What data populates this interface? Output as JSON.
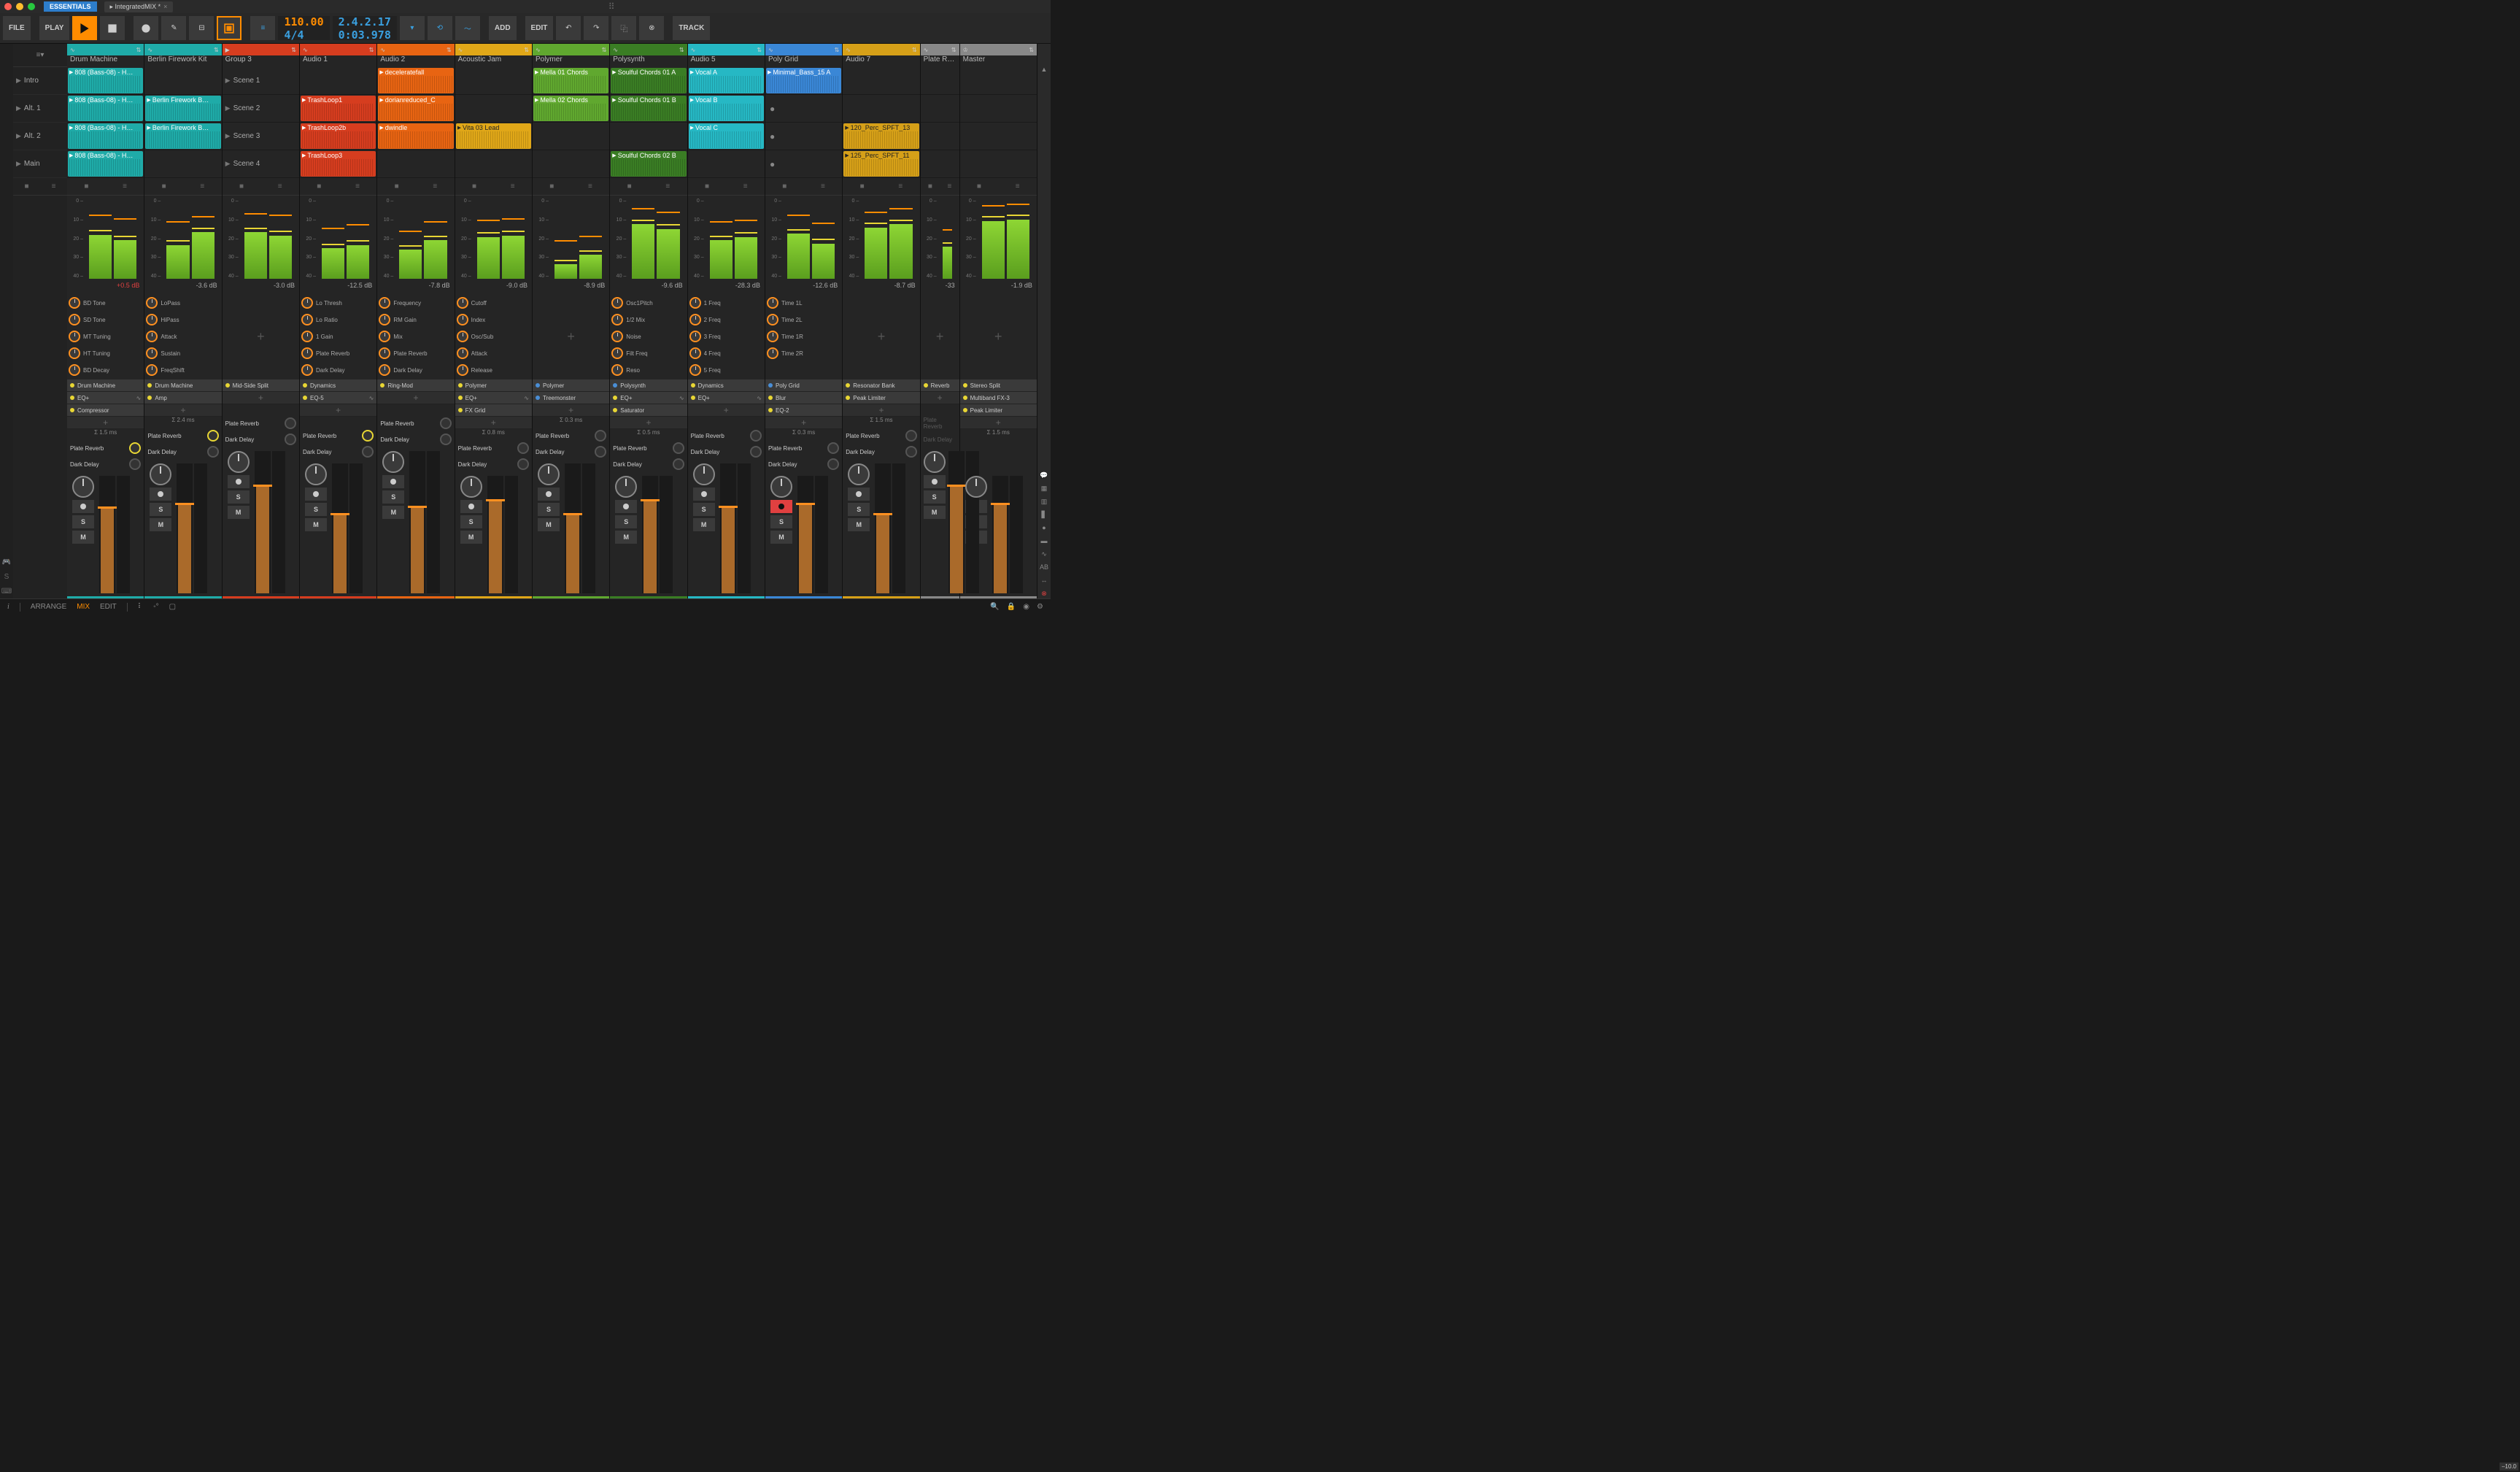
{
  "titlebar": {
    "badge": "ESSENTIALS",
    "document": "IntegratedMIX *"
  },
  "toolbar": {
    "file": "FILE",
    "play": "PLAY",
    "add": "ADD",
    "edit": "EDIT",
    "track": "TRACK",
    "tempo": "110.00",
    "sig": "4/4",
    "pos_bars": "2.4.2.17",
    "pos_time": "0:03.978"
  },
  "scenes": [
    "Intro",
    "Alt. 1",
    "Alt. 2",
    "Main"
  ],
  "meter_scale": [
    "0 –",
    "10 –",
    "20 –",
    "30 –",
    "40 –"
  ],
  "send_labels": {
    "a": "Plate Reverb",
    "b": "Dark Delay"
  },
  "fader_btns": {
    "solo": "S",
    "mute": "M"
  },
  "tracks": [
    {
      "name": "Drum Machine",
      "color": "#1faba8",
      "db": "+0.5 dB",
      "db_red": true,
      "fader": "–2.7",
      "fh": 72,
      "meters": [
        [
          55,
          78
        ],
        [
          48,
          74
        ]
      ],
      "clips": [
        {
          "t": "808 (Bass-08) - H…",
          "c": "teal"
        },
        {
          "t": "808 (Bass-08) - H…",
          "c": "teal"
        },
        {
          "t": "808 (Bass-08) - H…",
          "c": "teal"
        },
        {
          "t": "808 (Bass-08) - H…",
          "c": "teal"
        }
      ],
      "knobs": [
        "BD Tone",
        "SD Tone",
        "MT Tuning",
        "HT Tuning",
        "BD Decay"
      ],
      "devs": [
        {
          "n": "Drum Machine"
        },
        {
          "n": "EQ+",
          "wave": true
        },
        {
          "n": "Compressor"
        }
      ],
      "lat": "Σ 1.5 ms",
      "sendA": true,
      "sendB": false
    },
    {
      "name": "Berlin Firework Kit",
      "color": "#1faba8",
      "db": "-3.6 dB",
      "fader": "–3.2",
      "fh": 68,
      "meters": [
        [
          42,
          70
        ],
        [
          58,
          76
        ]
      ],
      "clips": [
        null,
        {
          "t": "Berlin Firework B…",
          "c": "teal"
        },
        {
          "t": "Berlin Firework B…",
          "c": "teal"
        },
        null
      ],
      "knobs": [
        "LoPass",
        "HiPass",
        "Attack",
        "Sustain",
        "FreqShift"
      ],
      "devs": [
        {
          "n": "Drum Machine"
        },
        {
          "n": "Amp"
        }
      ],
      "lat": "Σ 2.4 ms",
      "sendA": true,
      "sendB": false
    },
    {
      "name": "Group 3",
      "color": "#d63d1f",
      "db": "-3.0 dB",
      "fader": "0.0",
      "fh": 75,
      "is_group": true,
      "meters": [
        [
          58,
          80
        ],
        [
          54,
          78
        ]
      ],
      "clips": [
        {
          "t": "Scene 1",
          "plain": true
        },
        {
          "t": "Scene 2",
          "plain": true
        },
        {
          "t": "Scene 3",
          "plain": true
        },
        {
          "t": "Scene 4",
          "plain": true
        }
      ],
      "knobs": [],
      "devs": [
        {
          "n": "Mid-Side Split"
        }
      ],
      "lat": "",
      "sendA": false,
      "sendB": false,
      "armed": false
    },
    {
      "name": "Audio 1",
      "color": "#d63d1f",
      "db": "-12.5 dB",
      "fader": "–10.0",
      "fh": 60,
      "meters": [
        [
          38,
          62
        ],
        [
          42,
          66
        ]
      ],
      "clips": [
        null,
        {
          "t": "TrashLoop1",
          "c": "red"
        },
        {
          "t": "TrashLoop2b",
          "c": "red"
        },
        {
          "t": "TrashLoop3",
          "c": "red"
        }
      ],
      "knobs": [
        "Lo Thresh",
        "Lo Ratio",
        "1 Gain",
        "Plate Reverb",
        "Dark Delay"
      ],
      "devs": [
        {
          "n": "Dynamics"
        },
        {
          "n": "EQ-5",
          "wave": true
        }
      ],
      "lat": "",
      "sendA": true,
      "sendB": false
    },
    {
      "name": "Audio 2",
      "color": "#e86412",
      "db": "-7.8 dB",
      "fader": "–10.0",
      "fh": 60,
      "meters": [
        [
          36,
          58
        ],
        [
          48,
          70
        ]
      ],
      "clips": [
        {
          "t": "deceleratefall",
          "c": "orange"
        },
        {
          "t": "dorianreduced_C",
          "c": "orange"
        },
        {
          "t": "dwindle",
          "c": "orange"
        },
        null
      ],
      "knobs": [
        "Frequency",
        "RM Gain",
        "Mix",
        "Plate Reverb",
        "Dark Delay"
      ],
      "devs": [
        {
          "n": "Ring-Mod"
        }
      ],
      "lat": "",
      "sendA": false,
      "sendB": false
    },
    {
      "name": "Acoustic Jam",
      "color": "#e0a718",
      "db": "-9.0 dB",
      "fader": "+3.3",
      "fh": 78,
      "meters": [
        [
          52,
          72
        ],
        [
          54,
          74
        ]
      ],
      "clips": [
        null,
        null,
        {
          "t": "Vita 03 Lead",
          "c": "yellow"
        },
        null
      ],
      "knobs": [
        "Cutoff",
        "Index",
        "Osc/Sub",
        "Attack",
        "Release"
      ],
      "devs": [
        {
          "n": "Polymer"
        },
        {
          "n": "EQ+",
          "wave": true
        },
        {
          "n": "FX Grid"
        }
      ],
      "lat": "Σ 0.8 ms",
      "sendA": false,
      "sendB": false
    },
    {
      "name": "Polymer",
      "color": "#60a82f",
      "db": "-8.9 dB",
      "fader": "–10.0",
      "fh": 60,
      "meters": [
        [
          18,
          46
        ],
        [
          30,
          52
        ]
      ],
      "clips": [
        {
          "t": "Mella 01 Chords",
          "c": "green"
        },
        {
          "t": "Mella 02 Chords",
          "c": "green"
        },
        null,
        null
      ],
      "knobs": [],
      "devs": [
        {
          "n": "Polymer",
          "moon": true
        },
        {
          "n": "Treemonster",
          "moon": true
        }
      ],
      "lat": "Σ 0.3 ms",
      "sendA": false,
      "sendB": false
    },
    {
      "name": "Polysynth",
      "color": "#3a7d24",
      "db": "-9.6 dB",
      "fader": "+2.0",
      "fh": 78,
      "meters": [
        [
          68,
          86
        ],
        [
          62,
          82
        ]
      ],
      "clips": [
        {
          "t": "Soulful Chords 01 A",
          "c": "green-d"
        },
        {
          "t": "Soulful Chords 01 B",
          "c": "green-d"
        },
        null,
        {
          "t": "Soulful Chords 02 B",
          "c": "green-d"
        }
      ],
      "knobs": [
        "Osc1Pitch",
        "1/2 Mix",
        "Noise",
        "Filt Freq",
        "Reso"
      ],
      "devs": [
        {
          "n": "Polysynth",
          "moon": true
        },
        {
          "n": "EQ+",
          "wave": true
        },
        {
          "n": "Saturator"
        }
      ],
      "lat": "Σ 0.5 ms",
      "sendA": false,
      "sendB": false
    },
    {
      "name": "Audio 5",
      "color": "#26b8c4",
      "db": "-28.3 dB",
      "fader": "–4.4",
      "fh": 66,
      "meters": [
        [
          48,
          70
        ],
        [
          52,
          72
        ]
      ],
      "clips": [
        {
          "t": "Vocal A",
          "c": "cyan"
        },
        {
          "t": "Vocal B",
          "c": "cyan"
        },
        {
          "t": "Vocal C",
          "c": "cyan"
        },
        null
      ],
      "knobs": [
        "1 Freq",
        "2 Freq",
        "3 Freq",
        "4 Freq",
        "5 Freq"
      ],
      "devs": [
        {
          "n": "Dynamics"
        },
        {
          "n": "EQ+",
          "wave": true
        }
      ],
      "lat": "",
      "sendA": false,
      "sendB": false
    },
    {
      "name": "Poly Grid",
      "color": "#3a87d6",
      "db": "-12.6 dB",
      "fader": "0.0",
      "fh": 75,
      "armed": true,
      "meters": [
        [
          56,
          78
        ],
        [
          44,
          68
        ]
      ],
      "clips": [
        {
          "t": "Minimal_Bass_15 A",
          "c": "blue"
        },
        {
          "t": "",
          "dot": true
        },
        {
          "t": "",
          "dot": true
        },
        {
          "t": "",
          "dot": true
        }
      ],
      "knobs": [
        "Time 1L",
        "Time 2L",
        "Time 1R",
        "Time 2R"
      ],
      "devs": [
        {
          "n": "Poly Grid",
          "moon": true
        },
        {
          "n": "Blur"
        },
        {
          "n": "EQ-2"
        }
      ],
      "lat": "Σ 0.3 ms",
      "sendA": false,
      "sendB": false
    },
    {
      "name": "Audio 7",
      "color": "#d6a018",
      "db": "-8.7 dB",
      "fader": "–10.0",
      "fh": 60,
      "meters": [
        [
          64,
          82
        ],
        [
          68,
          86
        ]
      ],
      "clips": [
        null,
        null,
        {
          "t": "120_Perc_SPFT_13",
          "c": "amber"
        },
        {
          "t": "125_Perc_SPFT_11",
          "c": "amber"
        }
      ],
      "knobs": [],
      "devs": [
        {
          "n": "Resonator Bank"
        },
        {
          "n": "Peak Limiter"
        }
      ],
      "lat": "Σ 1.5 ms",
      "sendA": false,
      "sendB": false
    },
    {
      "name": "Plate Reverb",
      "color": "#888",
      "db": "-33",
      "fader": "",
      "fh": 75,
      "narrow": true,
      "meters": [
        [
          40,
          60
        ]
      ],
      "clips": [
        null,
        null,
        null,
        null
      ],
      "knobs": [],
      "devs": [
        {
          "n": "Reverb"
        }
      ],
      "lat": "",
      "sendA": false,
      "sendB": false,
      "no_sends": true
    },
    {
      "name": "Master",
      "color": "#888",
      "db": "-1.9 dB",
      "fader": "",
      "fh": 75,
      "is_master": true,
      "meters": [
        [
          72,
          90
        ],
        [
          74,
          92
        ]
      ],
      "clips": [
        null,
        null,
        null,
        null
      ],
      "knobs": [],
      "devs": [
        {
          "n": "Stereo Split"
        },
        {
          "n": "Multiband FX-3"
        },
        {
          "n": "Peak Limiter"
        }
      ],
      "lat": "Σ 1.5 ms",
      "sendA": false,
      "sendB": false,
      "no_sends": true
    }
  ],
  "bottom": {
    "arrange": "ARRANGE",
    "mix": "MIX",
    "edit": "EDIT"
  }
}
